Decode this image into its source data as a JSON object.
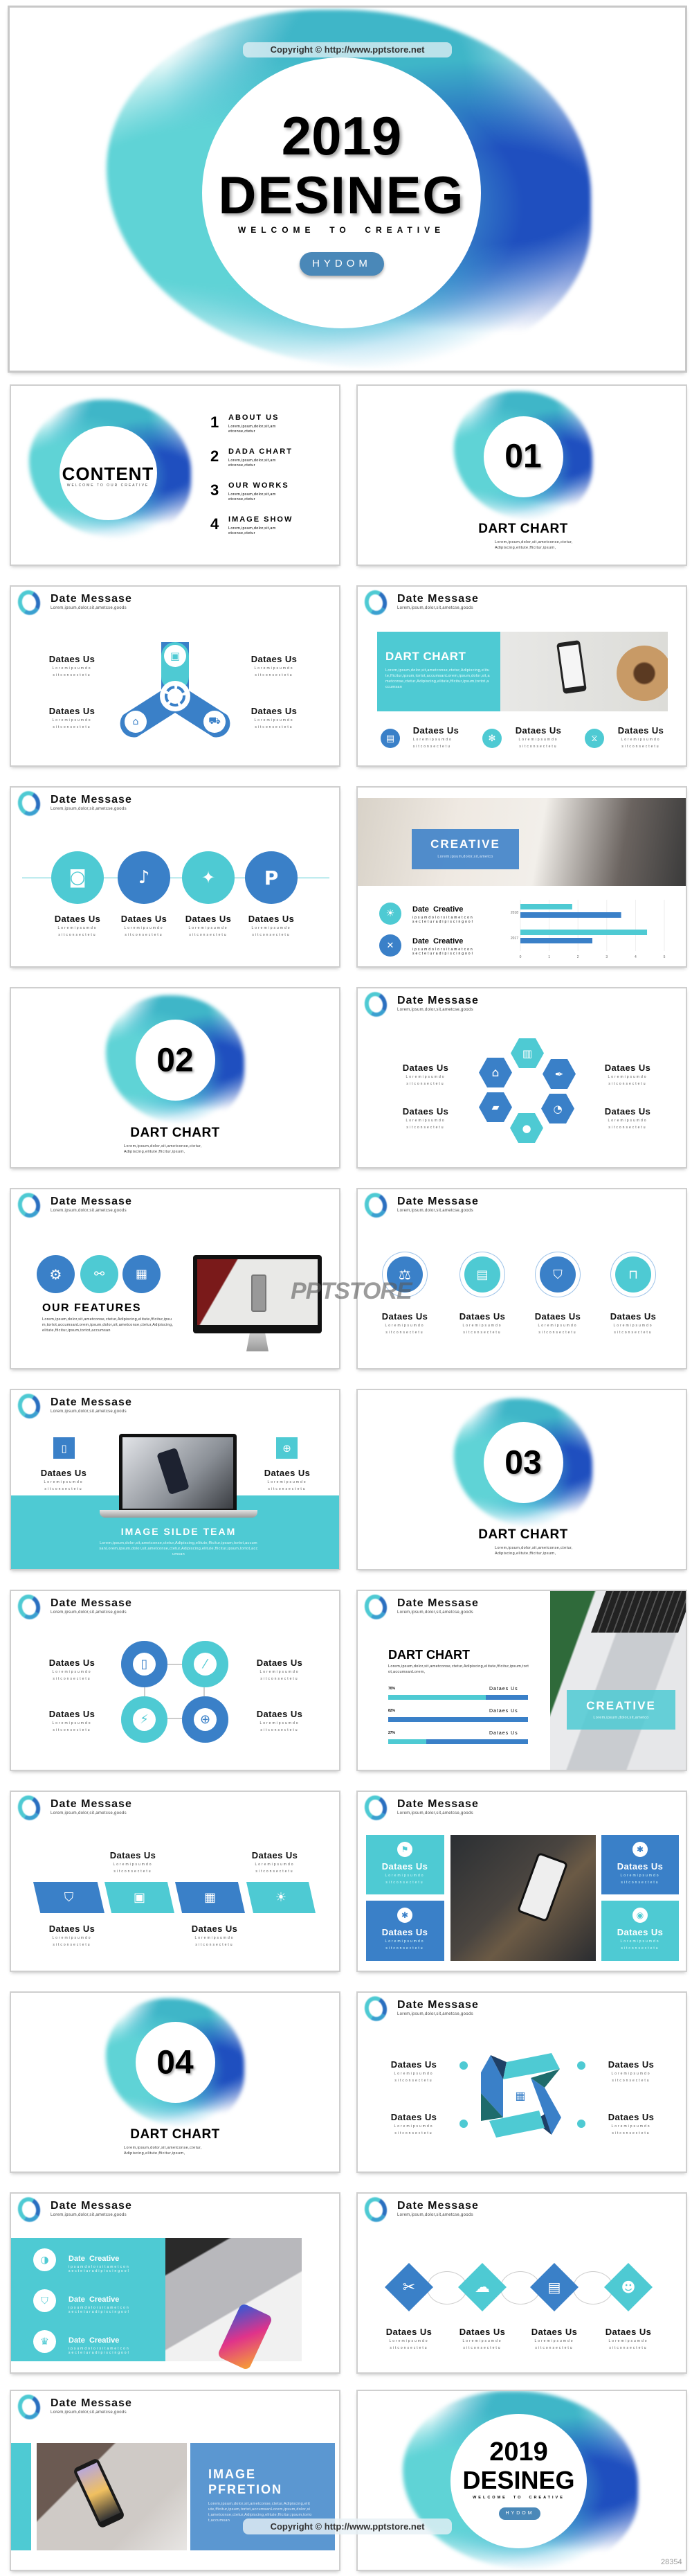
{
  "colors": {
    "teal": "#4ecad3",
    "blue": "#3a80c8",
    "dark": "#1e3f66",
    "pill": "#4a88b8"
  },
  "cover": {
    "copyright": "Copyright © http://www.pptstore.net",
    "year": "2019",
    "title": "DESINEG",
    "tagline": "WELCOME  TO  CREATIVE",
    "button": "HYDOM"
  },
  "common": {
    "header_title": "Date Messase",
    "header_sub": "Lorem,ipsum,dolor,sit,ametcse,goods",
    "item_title": "Dataes Us",
    "item_desc_1": "Loremipsumdo",
    "item_desc_2": "sitconsectetu",
    "section_title": "DART CHART",
    "section_desc_1": "Lorem,ipsum,dolor,sit,ametconse,ctetur,",
    "section_desc_2": "Adipiscing,elitute,fficitur,ipsum,",
    "creative_title": "Date  Creative",
    "creative_desc_1": "ipsumdolorsitametcon",
    "creative_desc_2": "secteturadipiscingool"
  },
  "contents": {
    "title": "CONTENT",
    "subtitle": "WELCOME TO OUR CREATIVE",
    "desc_1": "Lorem,ipsum,dolor,sit,am",
    "desc_2": "etconse,ctetur",
    "items": [
      {
        "num": "1",
        "label": "ABOUT US"
      },
      {
        "num": "2",
        "label": "DADA CHART"
      },
      {
        "num": "3",
        "label": "OUR WORKS"
      },
      {
        "num": "4",
        "label": "IMAGE SHOW"
      }
    ]
  },
  "sections": [
    "01",
    "02",
    "03",
    "04"
  ],
  "dart_card": {
    "title": "DART CHART",
    "desc": "Lorem,ipsum,dolor,sit,ametconse,ctetur,Adipiscing,elitute,fficitur,ipsum,tortot,accumsanLorem,ipsum,dolor,sit,ametconse,ctetur,Adipiscing,elitute,fficitur,ipsum,tortot,accumsan"
  },
  "creative_banner": {
    "title": "CREATIVE",
    "sub": "Lorem,ipsum,dolor,sit,ametco"
  },
  "chart_data": {
    "type": "bar",
    "orientation": "horizontal",
    "categories": [
      "2018",
      "2017"
    ],
    "series": [
      {
        "color": "#4ecad3",
        "values": [
          1.8,
          4.4
        ]
      },
      {
        "color": "#3a80c8",
        "values": [
          3.5,
          2.5
        ]
      }
    ],
    "xlim": [
      0,
      5
    ],
    "xticks": [
      "0",
      "1",
      "2",
      "3",
      "4",
      "5"
    ],
    "grid": true
  },
  "features": {
    "title": "OUR FEATURES",
    "desc": "Lorem,ipsum,dolor,sit,ametconse,ctetur,Adipiscing,elitute,fficitur,ipsum,tortot,accumsanLorem,ipsum,dolor,sit,ametconse,ctetur,Adipiscing,elitute,fficitur,ipsum,tortot,accumsan"
  },
  "watermark": "PPTSTORE",
  "image_slide": {
    "title": "IMAGE SILDE TEAM",
    "desc": "Lorem,ipsum,dolor,sit,ametconse,ctetur,Adipiscing,elitute,fficitur,ipsum,tortot,accumsanLorem,ipsum,dolor,sit,ametconse,ctetur,Adipiscing,elitute,fficitur,ipsum,tortot,accumsan"
  },
  "progress": {
    "title": "DART CHART",
    "desc": "Lorem,ipsum,dolor,sit,ametconse,ctetur,Adipiscing,elitute,fficitur,ipsum,tortot,accumsanLorem,",
    "bars": [
      {
        "label": "70%",
        "value": 70,
        "name": "Dataes Us",
        "fill": "#4ecad3"
      },
      {
        "label": "82%",
        "value": 82,
        "name": "Dataes Us",
        "fill": "#3a80c8"
      },
      {
        "label": "27%",
        "value": 27,
        "name": "Dataes Us",
        "fill": "#4ecad3"
      }
    ]
  },
  "image_pfretion": {
    "title_1": "IMAGE",
    "title_2": "PFRETION",
    "desc": "Lorem,ipsum,dolor,sit,ametconse,ctetur,Adipiscing,elitute,fficitur,ipsum,tortot,accumsanLorem,ipsum,dolor,sit,ametconse,ctetur,Adipiscing,elitute,fficitur,ipsum,tortot,accumsan"
  },
  "footer_id": "28354"
}
